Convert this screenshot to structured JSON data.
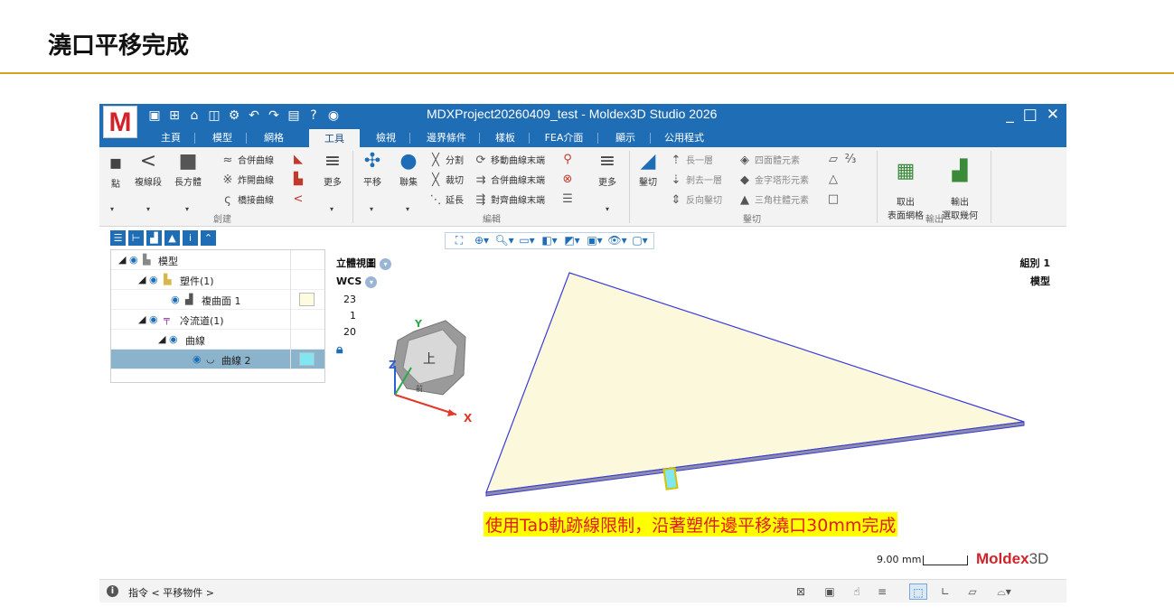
{
  "slide": {
    "title": "澆口平移完成"
  },
  "app": {
    "logo": "M",
    "window_title": "MDXProject20260409_test - Moldex3D Studio 2026",
    "window_controls": [
      "_",
      "□",
      "✕"
    ],
    "quick_access": [
      "save-icon",
      "new-icon",
      "open-icon",
      "view-icon",
      "settings-icon",
      "undo-icon",
      "redo-icon",
      "help-doc-icon",
      "help-icon",
      "camera-icon"
    ],
    "tabs": [
      "主頁",
      "模型",
      "網格",
      "工具",
      "檢視",
      "邊界條件",
      "樣板",
      "FEA介面",
      "顯示",
      "公用程式"
    ],
    "active_tab": "工具"
  },
  "ribbon": {
    "create": {
      "label": "創建",
      "point": "點",
      "polyline": "複線段",
      "box": "長方體",
      "merge_curve": "合併曲線",
      "explode_curve": "炸開曲線",
      "bridge_curve": "橋接曲線",
      "more": "更多"
    },
    "translate": "平移",
    "union": "聯集",
    "edit": {
      "label": "編輯",
      "split": "分割",
      "trim": "裁切",
      "extend": "延長",
      "move_curve_end": "移動曲線末端",
      "merge_curve_end": "合併曲線末端",
      "align_curve_end": "對齊曲線末端",
      "more": "更多"
    },
    "trim_mesh": {
      "label": "鑿切",
      "trim": "鑿切",
      "grow_layer": "長一層",
      "remove_layer": "剝去一層",
      "reverse_trim": "反向鑿切",
      "tetra": "四面體元素",
      "pyramid": "金字塔形元素",
      "prism": "三角柱體元素"
    },
    "output": {
      "label": "輸出",
      "extract_surface_mesh": "取出\n表面網格",
      "output_selected_geometry": "輸出\n選取幾何"
    }
  },
  "tree": {
    "rows": [
      {
        "label": "模型",
        "level": 0
      },
      {
        "label": "塑件(1)",
        "level": 1
      },
      {
        "label": "複曲面 1",
        "level": 2,
        "swatch": "#fdfbe0"
      },
      {
        "label": "冷流道(1)",
        "level": 1
      },
      {
        "label": "曲線",
        "level": 2
      },
      {
        "label": "曲線 2",
        "level": 3,
        "swatch": "#7fe6f2",
        "selected": true
      }
    ]
  },
  "viewport": {
    "view_label": "立體視圖",
    "coord": "WCS",
    "values": [
      "23",
      "1",
      "20"
    ],
    "group_label": "組別 1",
    "model_label": "模型",
    "cube_top": "上",
    "cube_front": "前",
    "axis_x": "X",
    "axis_y": "Y",
    "axis_z": "Z",
    "caption": "使用Tab軌跡線限制，沿著塑件邊平移澆口30mm完成",
    "scale_text": "9.00 mm",
    "brand": "Moldex",
    "brand_suffix": "3D"
  },
  "status": {
    "command": "指令 < 平移物件 >"
  },
  "colors": {
    "accent": "#1f6db5",
    "brand": "#d2232a",
    "rule": "#d9a21b",
    "model_fill": "#fbf8dc",
    "model_edge": "#3b3bd9"
  }
}
